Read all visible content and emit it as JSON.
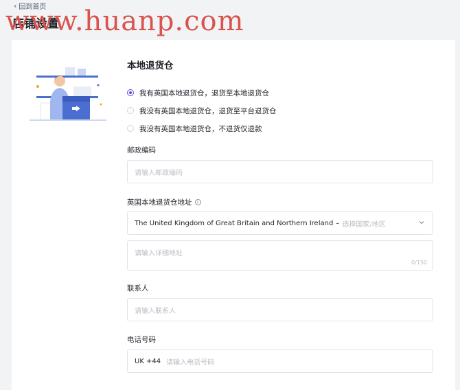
{
  "header": {
    "back_label": "回到首页",
    "title": "店铺设置"
  },
  "watermark": "www.huanp.com",
  "section": {
    "title": "本地退货仓"
  },
  "radios": [
    {
      "label": "我有英国本地退货仓，退货至本地退货仓",
      "checked": true
    },
    {
      "label": "我没有英国本地退货仓，退货至平台退货仓",
      "checked": false
    },
    {
      "label": "我没有英国本地退货仓，不退货仅退款",
      "checked": false
    }
  ],
  "postcode": {
    "label": "邮政编码",
    "placeholder": "请输入邮政编码"
  },
  "address": {
    "label": "英国本地退货仓地址",
    "info_icon": "info-circle-icon",
    "country_value": "The United Kingdom of Great Britain and Northern Ireland",
    "country_separator": "–",
    "country_hint": "选择国家/地区",
    "detail_placeholder": "请输入详细地址",
    "detail_counter": "0/150"
  },
  "contact": {
    "label": "联系人",
    "placeholder": "请输入联系人"
  },
  "phone": {
    "label": "电话号码",
    "prefix": "UK +44",
    "placeholder": "请输入电话号码"
  },
  "colors": {
    "accent": "#5b4bdb",
    "watermark": "#d9534f",
    "background": "#f2f3f5"
  }
}
